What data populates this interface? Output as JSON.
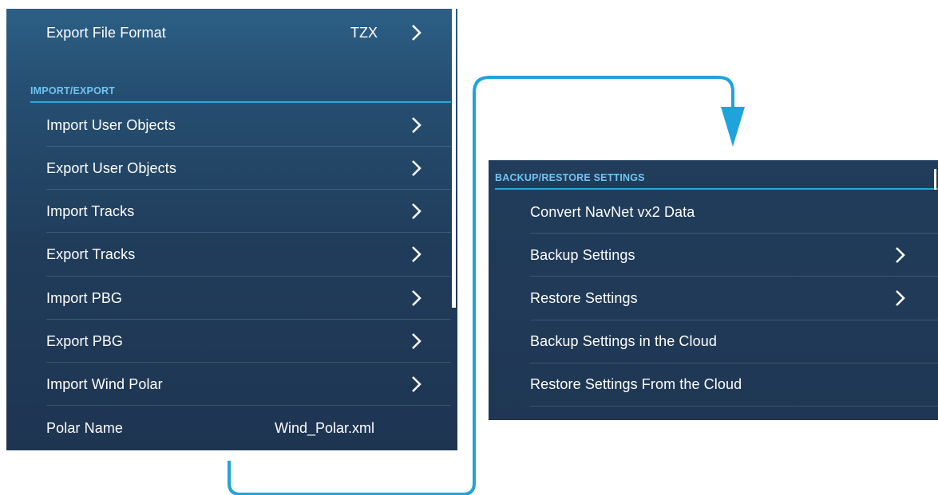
{
  "left_panel": {
    "export_file_format": {
      "label": "Export File Format",
      "value": "TZX"
    },
    "section_title": "IMPORT/EXPORT",
    "items": [
      {
        "label": "Import User Objects"
      },
      {
        "label": "Export User Objects"
      },
      {
        "label": "Import Tracks"
      },
      {
        "label": "Export Tracks"
      },
      {
        "label": "Import PBG"
      },
      {
        "label": "Export PBG"
      },
      {
        "label": "Import Wind Polar"
      }
    ],
    "polar_name": {
      "label": "Polar Name",
      "value": "Wind_Polar.xml"
    }
  },
  "right_panel": {
    "section_title": "BACKUP/RESTORE SETTINGS",
    "items": [
      {
        "label": "Convert NavNet vx2 Data",
        "has_chevron": false
      },
      {
        "label": "Backup Settings",
        "has_chevron": true
      },
      {
        "label": "Restore Settings",
        "has_chevron": true
      },
      {
        "label": "Backup Settings in the Cloud",
        "has_chevron": false
      },
      {
        "label": "Restore Settings From the Cloud",
        "has_chevron": false
      }
    ]
  },
  "colors": {
    "accent": "#25a9e0",
    "section_text": "#6fc4f2",
    "panel_bg": "#203c5a",
    "connector": "#1fa3dc"
  }
}
